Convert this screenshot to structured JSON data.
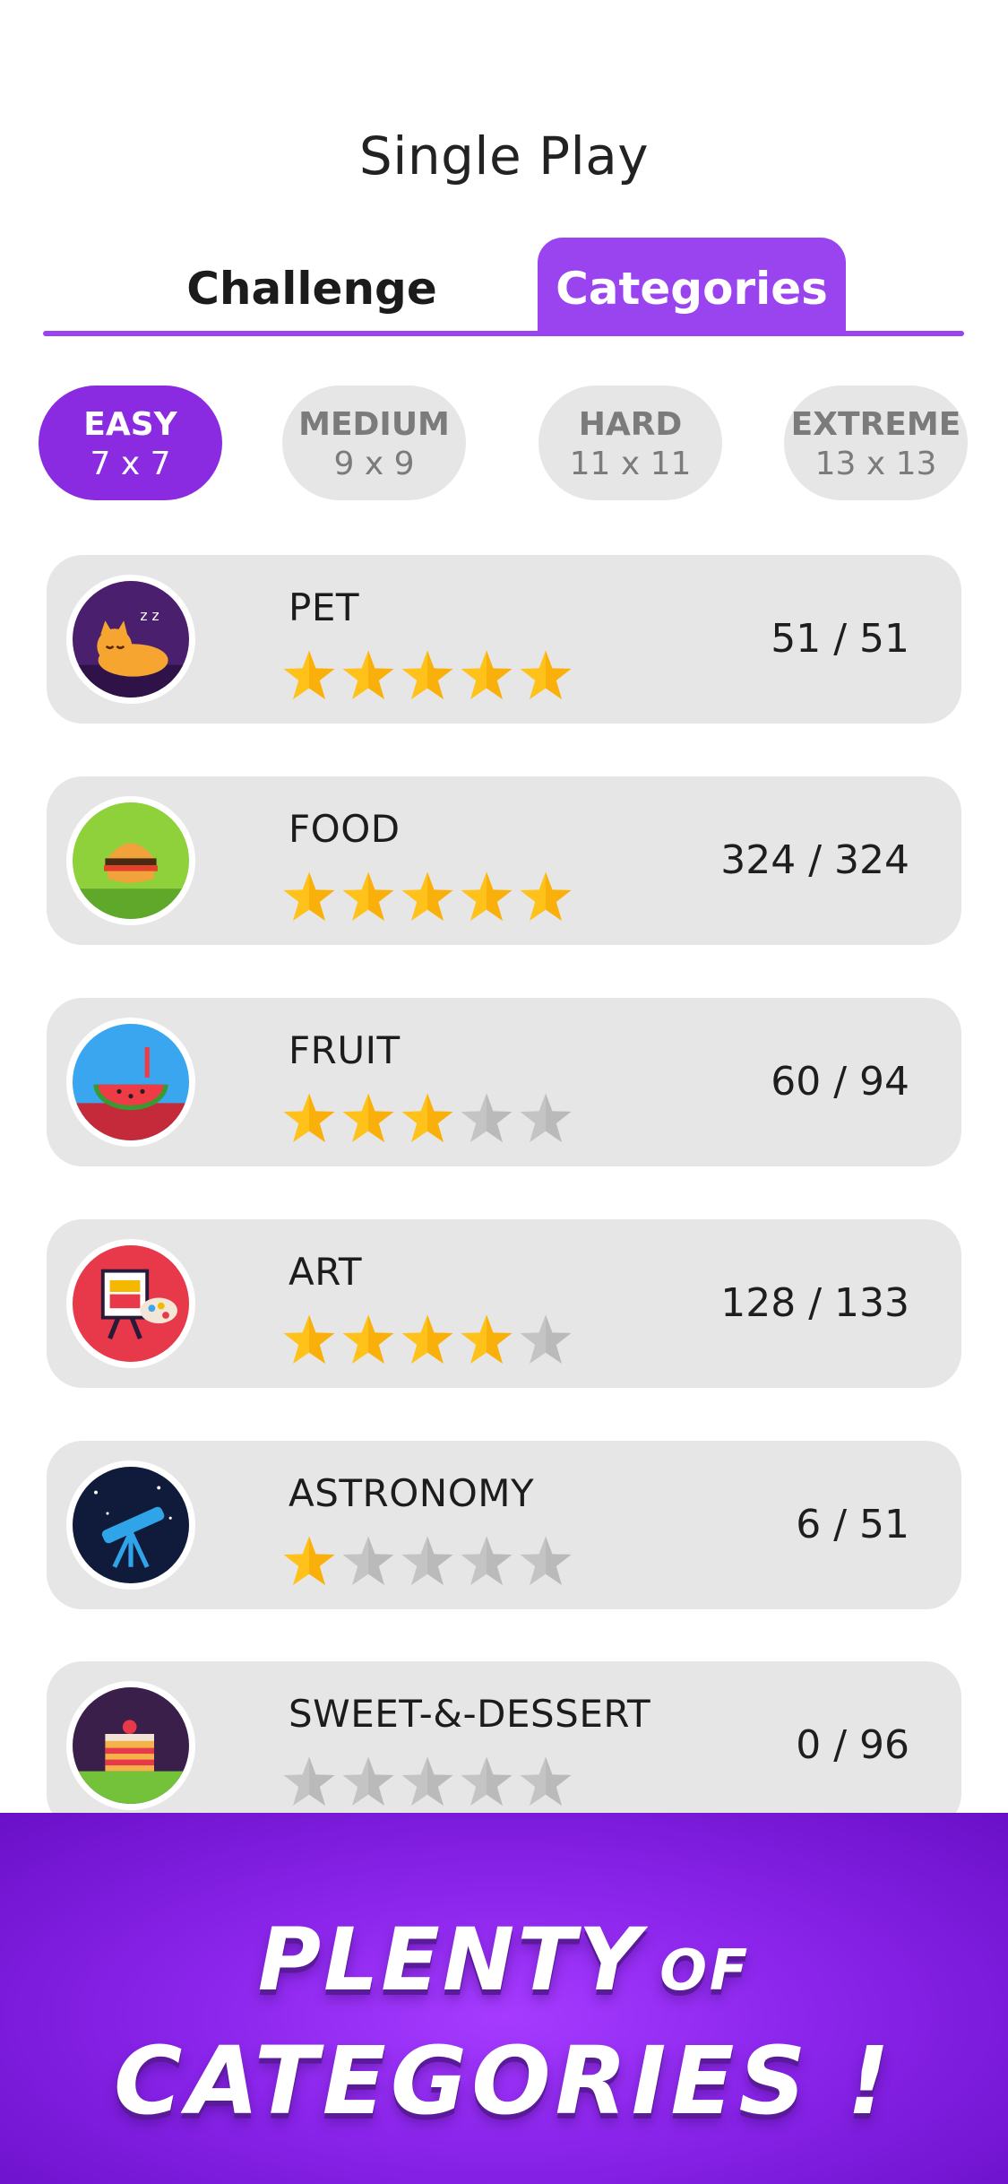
{
  "header": {
    "title": "Single Play"
  },
  "tabs": {
    "challenge": "Challenge",
    "categories": "Categories",
    "active": "categories"
  },
  "difficulties": [
    {
      "name": "EASY",
      "size": "7 x 7",
      "active": true
    },
    {
      "name": "MEDIUM",
      "size": "9 x 9",
      "active": false
    },
    {
      "name": "HARD",
      "size": "11 x 11",
      "active": false
    },
    {
      "name": "EXTREME",
      "size": "13 x 13",
      "active": false
    }
  ],
  "categories": [
    {
      "name": "PET",
      "icon": "sleeping-cat-icon",
      "stars": 5,
      "progress": "51 / 51"
    },
    {
      "name": "FOOD",
      "icon": "burger-icon",
      "stars": 5,
      "progress": "324 / 324"
    },
    {
      "name": "FRUIT",
      "icon": "watermelon-icon",
      "stars": 3,
      "progress": "60 / 94"
    },
    {
      "name": "ART",
      "icon": "easel-palette-icon",
      "stars": 4,
      "progress": "128 / 133"
    },
    {
      "name": "ASTRONOMY",
      "icon": "telescope-icon",
      "stars": 1,
      "progress": "6 / 51"
    },
    {
      "name": "SWEET-&-DESSERT",
      "icon": "cake-icon",
      "stars": 0,
      "progress": "0 / 96"
    }
  ],
  "banner": {
    "line1_big": "PLENTY",
    "line1_small": "OF",
    "line2": "CATEGORIES !"
  },
  "colors": {
    "accent": "#9a44f0",
    "star_on": "#ffc21a",
    "star_off": "#c4c4c4",
    "card_bg": "#e6e6e6"
  }
}
